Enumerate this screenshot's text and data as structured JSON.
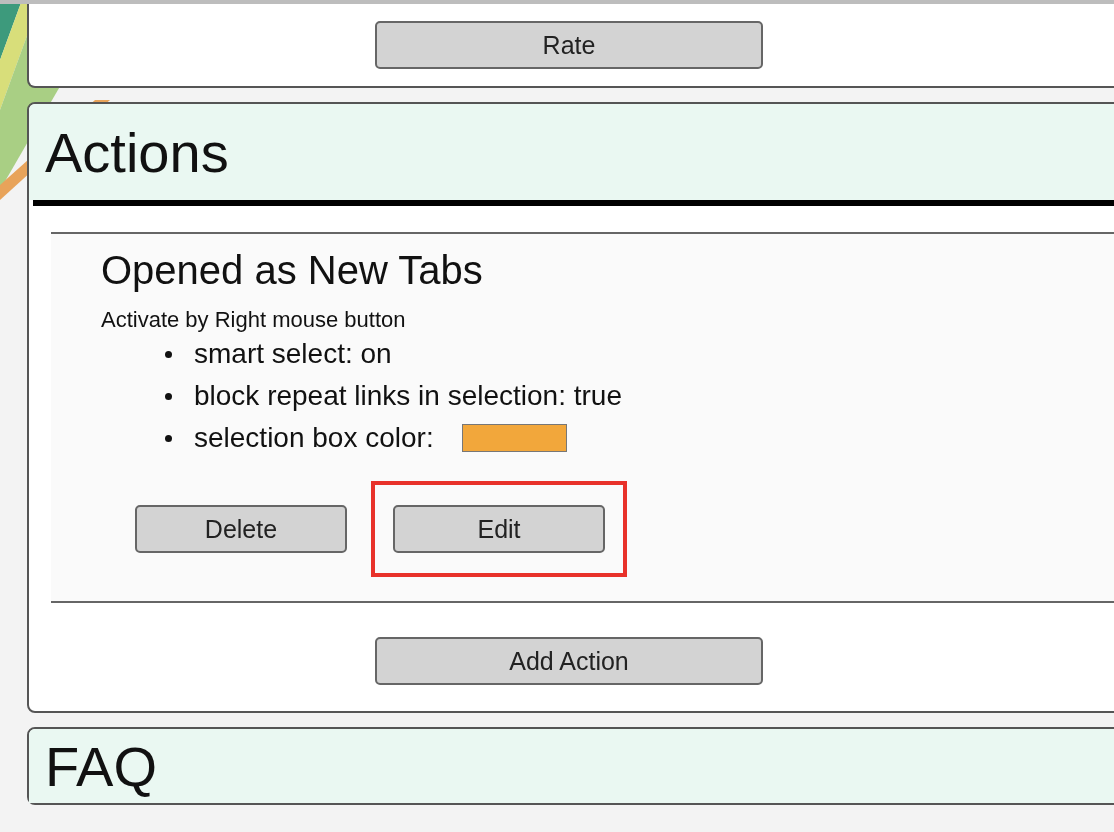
{
  "top_card": {
    "button": "Rate"
  },
  "actions": {
    "title": "Actions",
    "items": [
      {
        "title": "Opened as New Tabs",
        "activation": "Activate by Right mouse button",
        "settings": [
          {
            "kind": "text",
            "text": "smart select: on"
          },
          {
            "kind": "text",
            "text": "block repeat links in selection: true"
          },
          {
            "kind": "color",
            "text": "selection box color:",
            "color": "#f2a73b"
          }
        ],
        "buttons": [
          {
            "label": "Delete",
            "highlighted": false
          },
          {
            "label": "Edit",
            "highlighted": true
          }
        ]
      }
    ],
    "add_button": "Add Action"
  },
  "faq": {
    "title": "FAQ"
  }
}
